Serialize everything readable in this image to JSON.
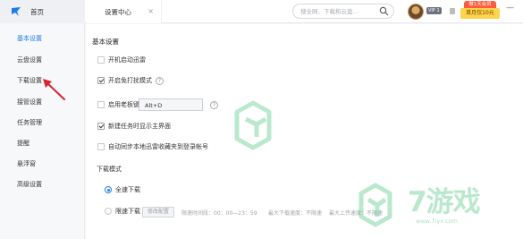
{
  "titlebar": {
    "home_label": "首页",
    "active_tab": "设置中心",
    "tab_close": "×",
    "search_placeholder": "搜全网、下载和云盘…",
    "vip_badge": "VIP 1",
    "promo_top": "做1天会员",
    "promo_button": "首月仅10元",
    "minimize": "—"
  },
  "sidebar": {
    "items": [
      {
        "label": "基本设置",
        "active": true
      },
      {
        "label": "云盘设置",
        "active": false
      },
      {
        "label": "下载设置",
        "active": false
      },
      {
        "label": "接管设置",
        "active": false
      },
      {
        "label": "任务管理",
        "active": false
      },
      {
        "label": "提醒",
        "active": false
      },
      {
        "label": "悬浮窗",
        "active": false
      },
      {
        "label": "高级设置",
        "active": false
      }
    ]
  },
  "basic": {
    "title": "基本设置",
    "options": [
      {
        "label": "开机启动迅雷",
        "checked": false
      },
      {
        "label": "开启免打扰模式",
        "checked": true
      },
      {
        "label": "启用老板键",
        "checked": false
      },
      {
        "label": "新建任务时显示主界面",
        "checked": true
      },
      {
        "label": "自动同步本地迅雷收藏夹到登录帐号",
        "checked": false
      }
    ],
    "hotkey_value": "Alt+D",
    "help_icon_text": "?"
  },
  "download_mode": {
    "title": "下载模式",
    "full_speed": "全速下载",
    "limited": "限速下载",
    "modify_button": "修改配置",
    "limit_period": "限速时间段：00：00—23：59",
    "max_download": "最大下载速度：不限速",
    "max_upload": "最大上传速度：不限速"
  },
  "watermark": {
    "brand": "7游戏",
    "url": "www.7iyx.com"
  },
  "colors": {
    "accent": "#1f7ce8",
    "watermark_green": "#3dbf72",
    "arrow_red": "#d9232e"
  }
}
